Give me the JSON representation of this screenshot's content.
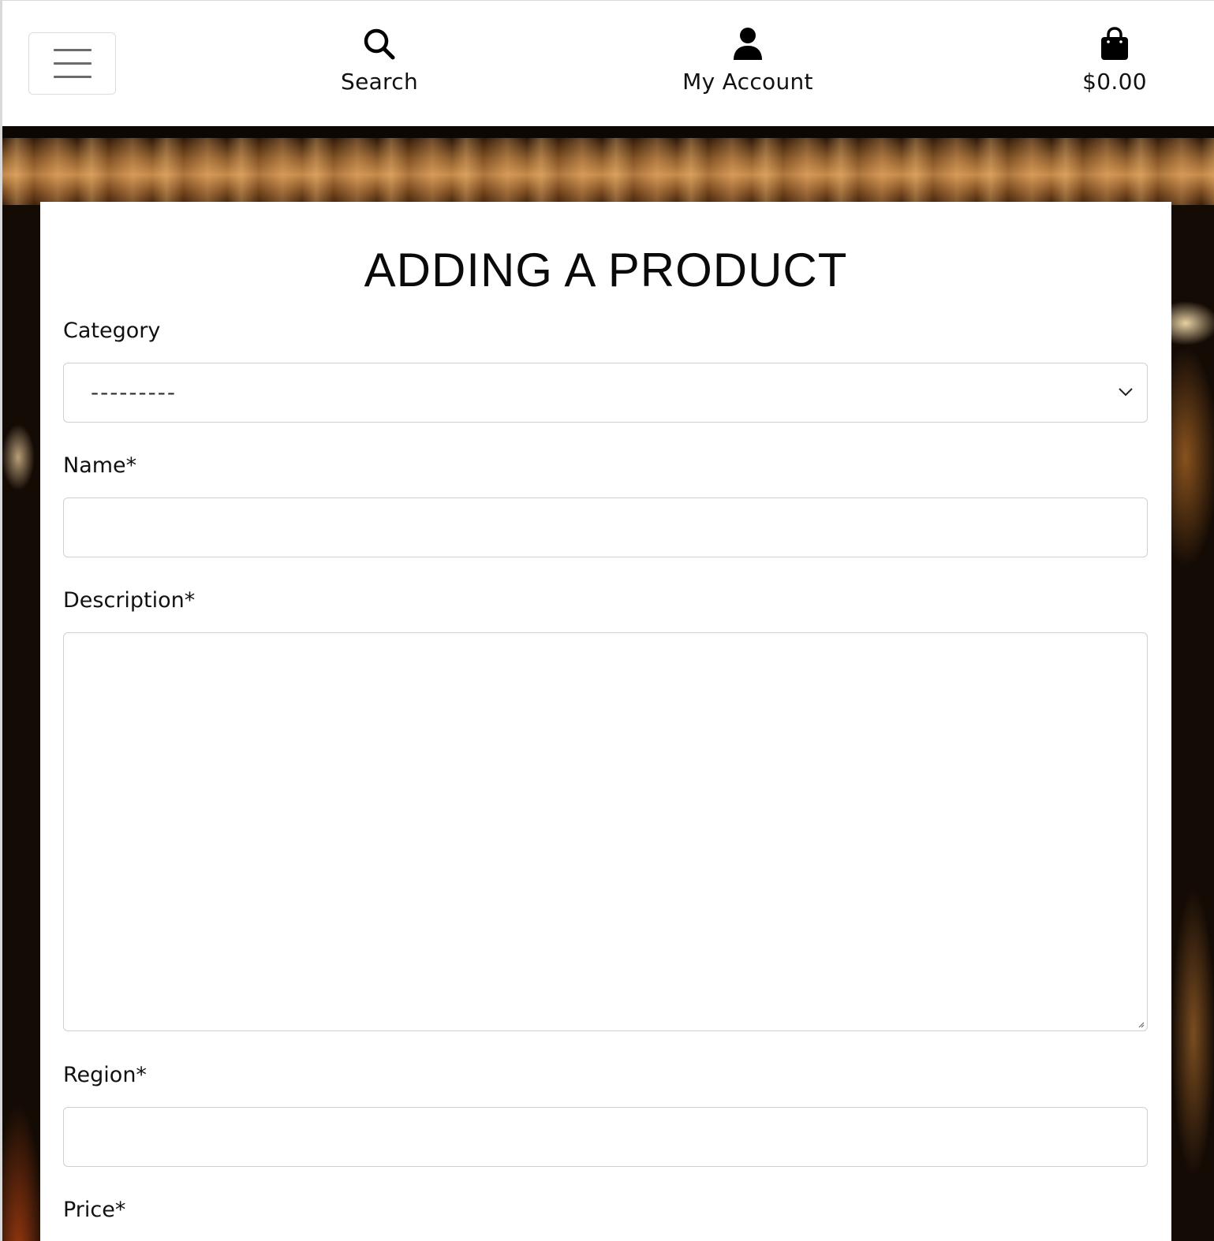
{
  "header": {
    "menu_label": "Toggle navigation",
    "search_label": "Search",
    "account_label": "My Account",
    "cart_total": "$0.00"
  },
  "icons": {
    "menu": "hamburger-icon",
    "search": "search-icon",
    "account": "user-icon",
    "cart": "shopping-bag-icon",
    "dropdown": "chevron-down-icon"
  },
  "form": {
    "title": "ADDING A PRODUCT",
    "category": {
      "label": "Category",
      "selected": "---------"
    },
    "name": {
      "label": "Name*",
      "value": ""
    },
    "description": {
      "label": "Description*",
      "value": ""
    },
    "region": {
      "label": "Region*",
      "value": ""
    },
    "price": {
      "label": "Price*"
    }
  }
}
